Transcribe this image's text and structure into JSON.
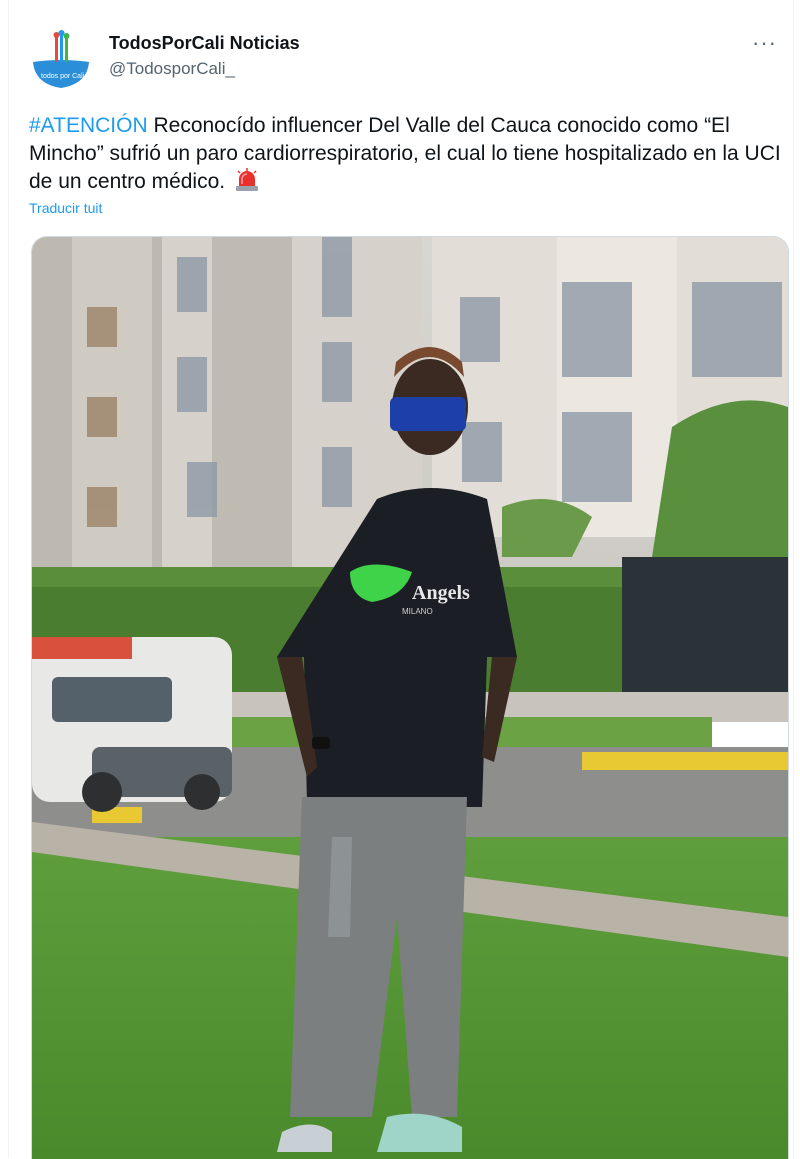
{
  "account": {
    "display_name": "TodosPorCali Noticias",
    "handle": "@TodosporCali_",
    "avatar_text": "todos por Cali"
  },
  "tweet": {
    "hashtag": "#ATENCIÓN",
    "body": " Reconocído influencer Del Valle del Cauca conocido como “El Mincho” sufrió un paro cardiorrespiratorio, el cual lo tiene hospitalizado en la UCI de un centro médico.",
    "emoji_icon": "rotating-light-icon",
    "translate_label": "Traducir tuit",
    "more_label": "···"
  },
  "photo": {
    "shirt_text": "Angels",
    "shirt_subtext": "MILANO",
    "accent_color": "#1d9bf0"
  }
}
